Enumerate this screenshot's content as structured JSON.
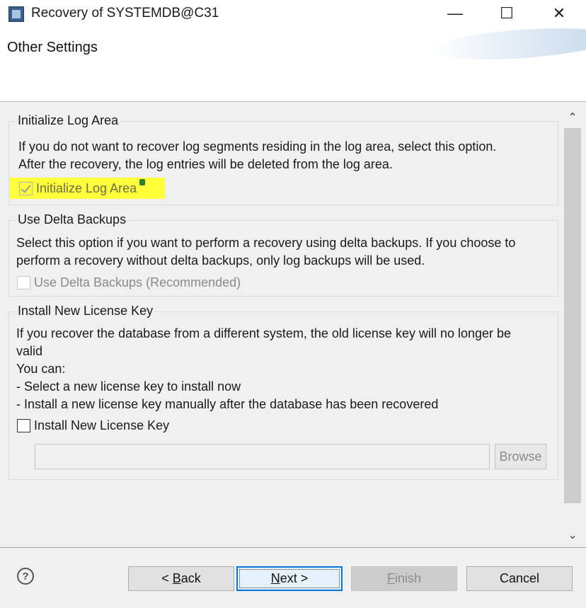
{
  "window": {
    "title": "Recovery of SYSTEMDB@C31",
    "minimize": "—",
    "maximize": "☐",
    "close": "✕"
  },
  "header": {
    "title": "Other Settings"
  },
  "groups": {
    "log_area": {
      "title": "Initialize Log Area",
      "description_lines": [
        "If you do not want to recover log segments residing in the log area, select this option.",
        "After the recovery, the log entries will be deleted from the log area."
      ],
      "checkbox_label": "Initialize Log Area",
      "checked": true,
      "enabled": false,
      "highlight_color": "#ffff3a"
    },
    "delta_backups": {
      "title": "Use Delta Backups",
      "description_lines": [
        "Select this option if you want to perform a recovery using delta backups. If you choose to",
        "perform a recovery without delta backups, only log backups will be used."
      ],
      "checkbox_label": "Use Delta Backups (Recommended)",
      "checked": false,
      "enabled": false
    },
    "license": {
      "title": "Install New License Key",
      "description_lines": [
        "If you recover the database from a different system, the old license key will no longer be",
        "valid",
        "You can:",
        "- Select a new license key to install now",
        "- Install a new license key manually after the database has been recovered"
      ],
      "checkbox_label": "Install New License Key",
      "checked": false,
      "path_value": "",
      "browse_label": "Browse"
    }
  },
  "footer": {
    "help_symbol": "?",
    "back": {
      "prefix": "< ",
      "mnemonic": "B",
      "rest": "ack"
    },
    "next": {
      "mnemonic": "N",
      "rest": "ext >"
    },
    "finish": {
      "mnemonic": "F",
      "rest": "inish"
    },
    "cancel": "Cancel"
  },
  "scrollbar": {
    "up": "⌃",
    "down": "⌄"
  },
  "icons": {
    "app": "app-icon",
    "help": "help-icon",
    "info": "info-icon"
  }
}
